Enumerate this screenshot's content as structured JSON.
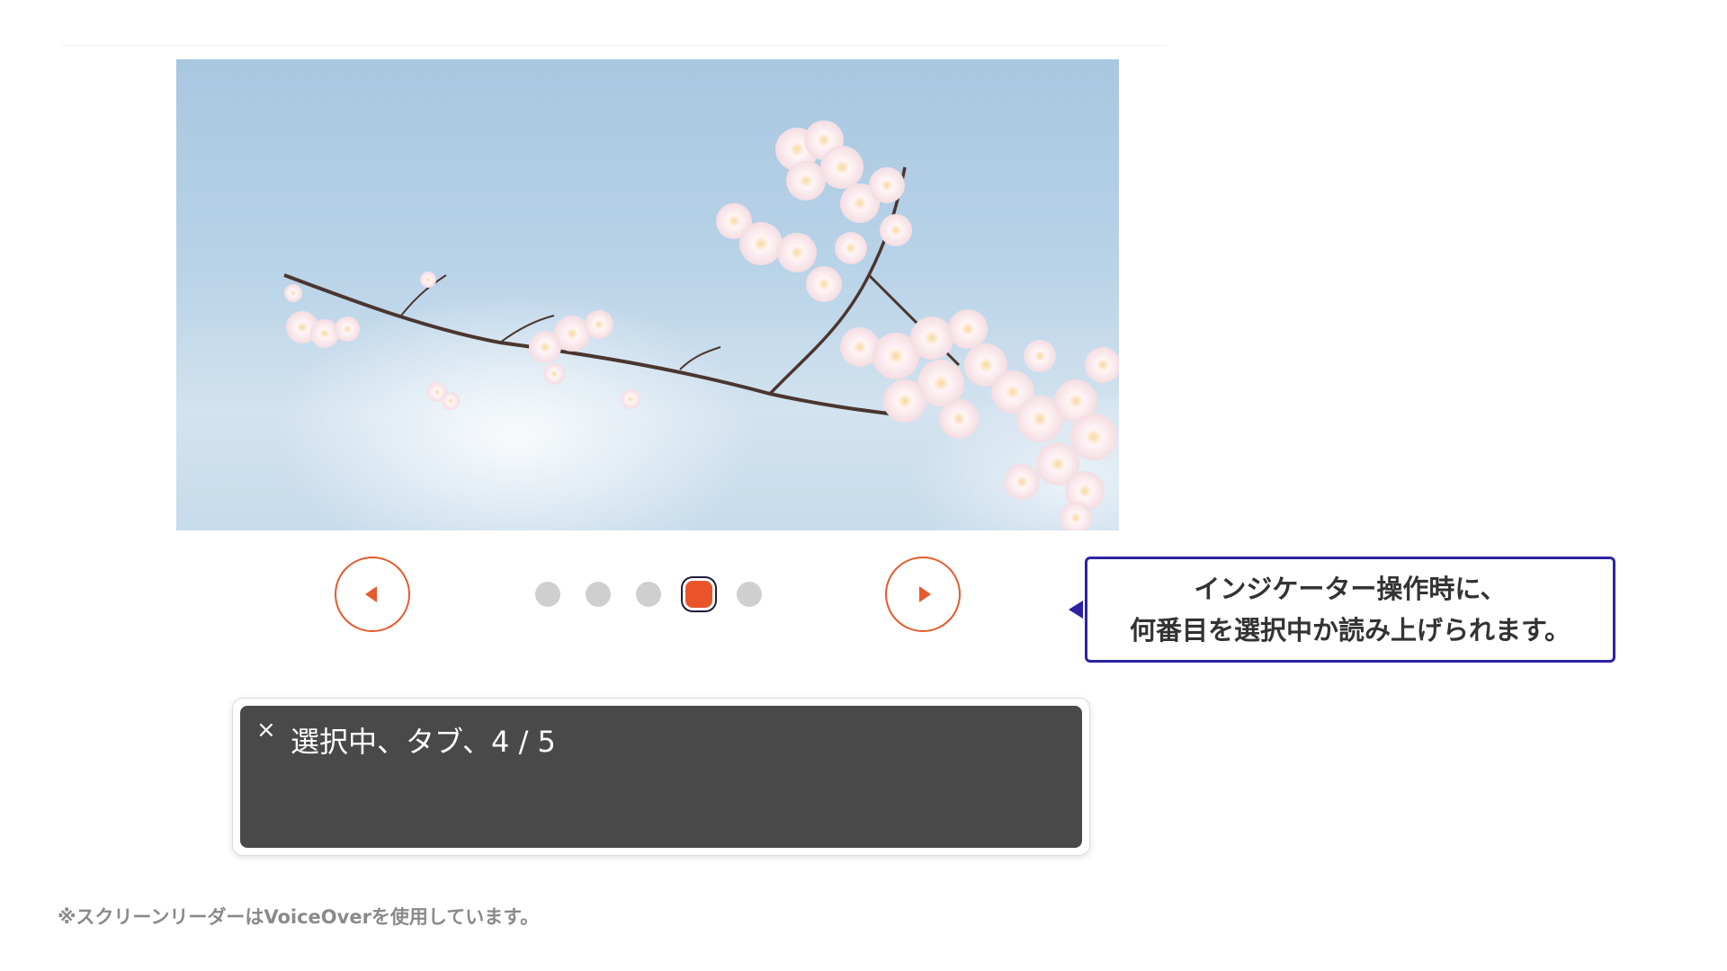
{
  "carousel": {
    "image_alt": "cherry blossom branch against blue sky",
    "prev_label": "previous",
    "next_label": "next",
    "indicator_count": 5,
    "current_index": 4
  },
  "callout": {
    "line1": "インジケーター操作時に、",
    "line2": "何番目を選択中か読み上げられます。"
  },
  "screen_reader": {
    "close_glyph": "×",
    "output": "選択中、タブ、4 / 5"
  },
  "footnote": "※スクリーンリーダーはVoiceOverを使用しています。",
  "colors": {
    "accent": "#e65a2d",
    "active_dot": "#e9542b",
    "callout_border": "#2b23a3",
    "sr_panel": "#494949"
  }
}
